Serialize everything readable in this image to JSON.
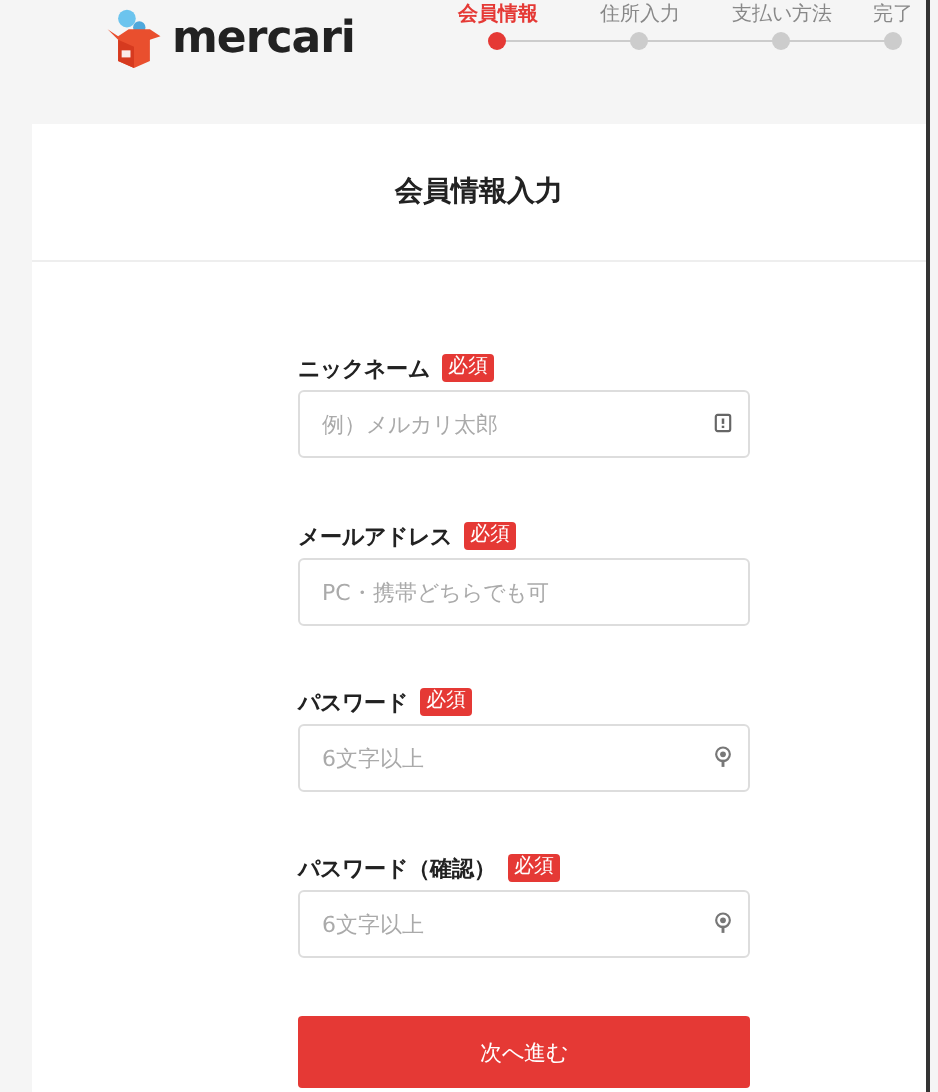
{
  "header": {
    "logo": "mercari",
    "steps": [
      {
        "label": "会員情報",
        "selected": true
      },
      {
        "label": "住所入力",
        "selected": false
      },
      {
        "label": "支払い方法",
        "selected": false
      },
      {
        "label": "完了",
        "selected": false
      }
    ]
  },
  "form": {
    "title": "会員情報入力",
    "fields": [
      {
        "kind": "text",
        "label": "ニックネーム",
        "badge": "必須",
        "placeholder": "例）メルカリ太郎"
      },
      {
        "kind": "email",
        "label": "メールアドレス",
        "badge": "必須",
        "placeholder": "PC・携帯どちらでも可"
      },
      {
        "kind": "password",
        "label": "パスワード",
        "badge": "必須",
        "placeholder": "6文字以上"
      },
      {
        "kind": "password",
        "label": "パスワード（確認）",
        "badge": "必須",
        "placeholder": "6文字以上"
      }
    ],
    "submit": "次へ進む"
  }
}
